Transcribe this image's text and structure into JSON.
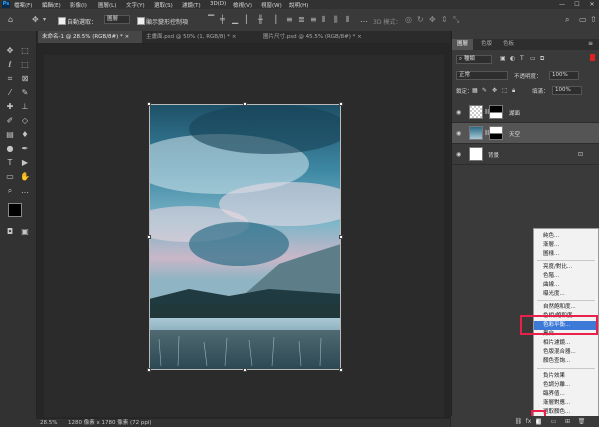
{
  "app": {
    "logo": "Ps"
  },
  "menubar": {
    "items": [
      "檔案(F)",
      "編輯(E)",
      "影像(I)",
      "圖層(L)",
      "文字(Y)",
      "選取(S)",
      "濾鏡(T)",
      "3D(D)",
      "檢視(V)",
      "視窗(W)",
      "說明(H)"
    ]
  },
  "window_controls": {
    "minimize": "—",
    "maximize": "☐",
    "close": "✕"
  },
  "options_bar": {
    "auto_select_label": "自動選取：",
    "auto_select_target": "圖層",
    "show_transform_label": "顯示變形控制項",
    "mode_3d_label": "3D 模式："
  },
  "tabs": [
    {
      "label": "未命名-1 @ 28.5% (RGB/8#) *",
      "close": "×"
    },
    {
      "label": "主畫面.psd @ 50% (1, RGB/8) *",
      "close": "×"
    },
    {
      "label": "圖片尺寸.psd @ 45.5% (RGB/8#) *",
      "close": "×"
    }
  ],
  "status": {
    "zoom": "28.5%",
    "doc_info": "1280 像素 x 1780 像素 (72 ppi)"
  },
  "layers_panel": {
    "tabs": [
      "圖層",
      "色版",
      "色板"
    ],
    "filter_kind": "種類",
    "blend_mode": "正常",
    "opacity_label": "不透明度：",
    "opacity_value": "100%",
    "lock_label": "鎖定：",
    "fill_label": "填滿：",
    "fill_value": "100%",
    "layers": [
      {
        "name": "湖面",
        "selected": false
      },
      {
        "name": "天空",
        "selected": true
      },
      {
        "name": "背景",
        "selected": false
      }
    ]
  },
  "adjustment_menu": {
    "groups": [
      [
        "純色...",
        "漸層...",
        "圖樣..."
      ],
      [
        "亮度/對比...",
        "色階...",
        "曲線...",
        "曝光度..."
      ],
      [
        "自然飽和度...",
        "色相/飽和度...",
        "色彩平衡...",
        "黑白...",
        "相片濾鏡...",
        "色版混合器...",
        "顏色查詢..."
      ],
      [
        "負片效果",
        "色調分離...",
        "臨界值...",
        "漸層對應...",
        "選取顏色..."
      ]
    ],
    "highlighted": "色彩平衡..."
  },
  "colors": {
    "accent": "#3d79d7",
    "highlight_box": "#e8204a",
    "panel_bg": "#3a3a3a",
    "canvas_bg": "#262626"
  }
}
